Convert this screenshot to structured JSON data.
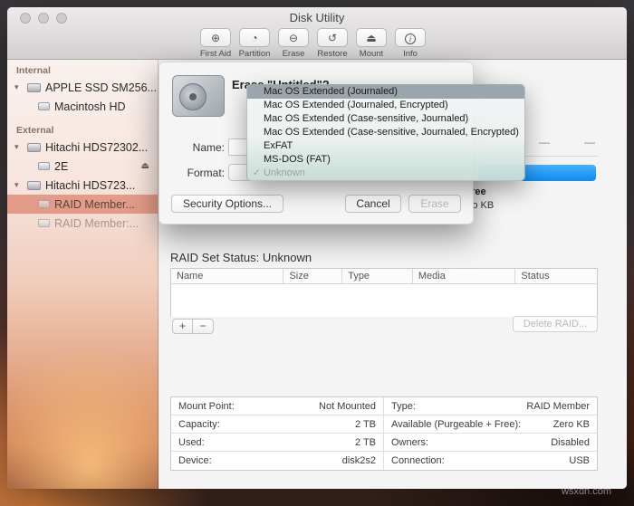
{
  "window": {
    "title": "Disk Utility"
  },
  "icons": {
    "first_aid": "⊕",
    "partition": "◔",
    "erase": "⊖",
    "restore": "↺",
    "mount": "⏏",
    "info": "i",
    "triangle_down": "▾",
    "eject": "⏏",
    "check": "✓"
  },
  "toolbar": {
    "items": [
      {
        "label": "First Aid"
      },
      {
        "label": "Partition"
      },
      {
        "label": "Erase"
      },
      {
        "label": "Restore"
      },
      {
        "label": "Mount"
      },
      {
        "label": "Info"
      }
    ]
  },
  "sidebar": {
    "internal_header": "Internal",
    "external_header": "External",
    "items": [
      {
        "label": "APPLE SSD SM256..."
      },
      {
        "label": "Macintosh HD"
      },
      {
        "label": "Hitachi HDS72302..."
      },
      {
        "label": "2E"
      },
      {
        "label": "Hitachi HDS723..."
      },
      {
        "label": "RAID Member..."
      },
      {
        "label": "RAID Member:..."
      }
    ]
  },
  "dialog": {
    "title": "Erase \"Untitled\"?",
    "name_label": "Name:",
    "format_label": "Format:",
    "security_button": "Security Options...",
    "cancel_button": "Cancel",
    "erase_button": "Erase"
  },
  "format_menu": {
    "items": [
      {
        "label": "Mac OS Extended (Journaled)"
      },
      {
        "label": "Mac OS Extended (Journaled, Encrypted)"
      },
      {
        "label": "Mac OS Extended (Case-sensitive, Journaled)"
      },
      {
        "label": "Mac OS Extended (Case-sensitive, Journaled, Encrypted)"
      },
      {
        "label": "ExFAT"
      },
      {
        "label": "MS-DOS (FAT)"
      },
      {
        "label": "Unknown"
      }
    ]
  },
  "main": {
    "dash_1": "—",
    "dash_2": "—",
    "free_label": "Free",
    "free_value": "Zero KB",
    "raid_status": "RAID Set Status: Unknown",
    "table_columns": [
      "Name",
      "Size",
      "Type",
      "Media",
      "Status"
    ],
    "add_label": "+",
    "remove_label": "−",
    "delete_raid_label": "Delete RAID...",
    "info_rows": [
      {
        "l_label": "Mount Point:",
        "l_value": "Not Mounted",
        "r_label": "Type:",
        "r_value": "RAID Member"
      },
      {
        "l_label": "Capacity:",
        "l_value": "2 TB",
        "r_label": "Available (Purgeable + Free):",
        "r_value": "Zero KB"
      },
      {
        "l_label": "Used:",
        "l_value": "2 TB",
        "r_label": "Owners:",
        "r_value": "Disabled"
      },
      {
        "l_label": "Device:",
        "l_value": "disk2s2",
        "r_label": "Connection:",
        "r_value": "USB"
      }
    ]
  },
  "colors": {
    "accent_blue": "#0d8bf2",
    "selection_salmon": "#d86e54",
    "menu_highlight": "#9aa5ae"
  },
  "watermark": "wsxdn.com"
}
